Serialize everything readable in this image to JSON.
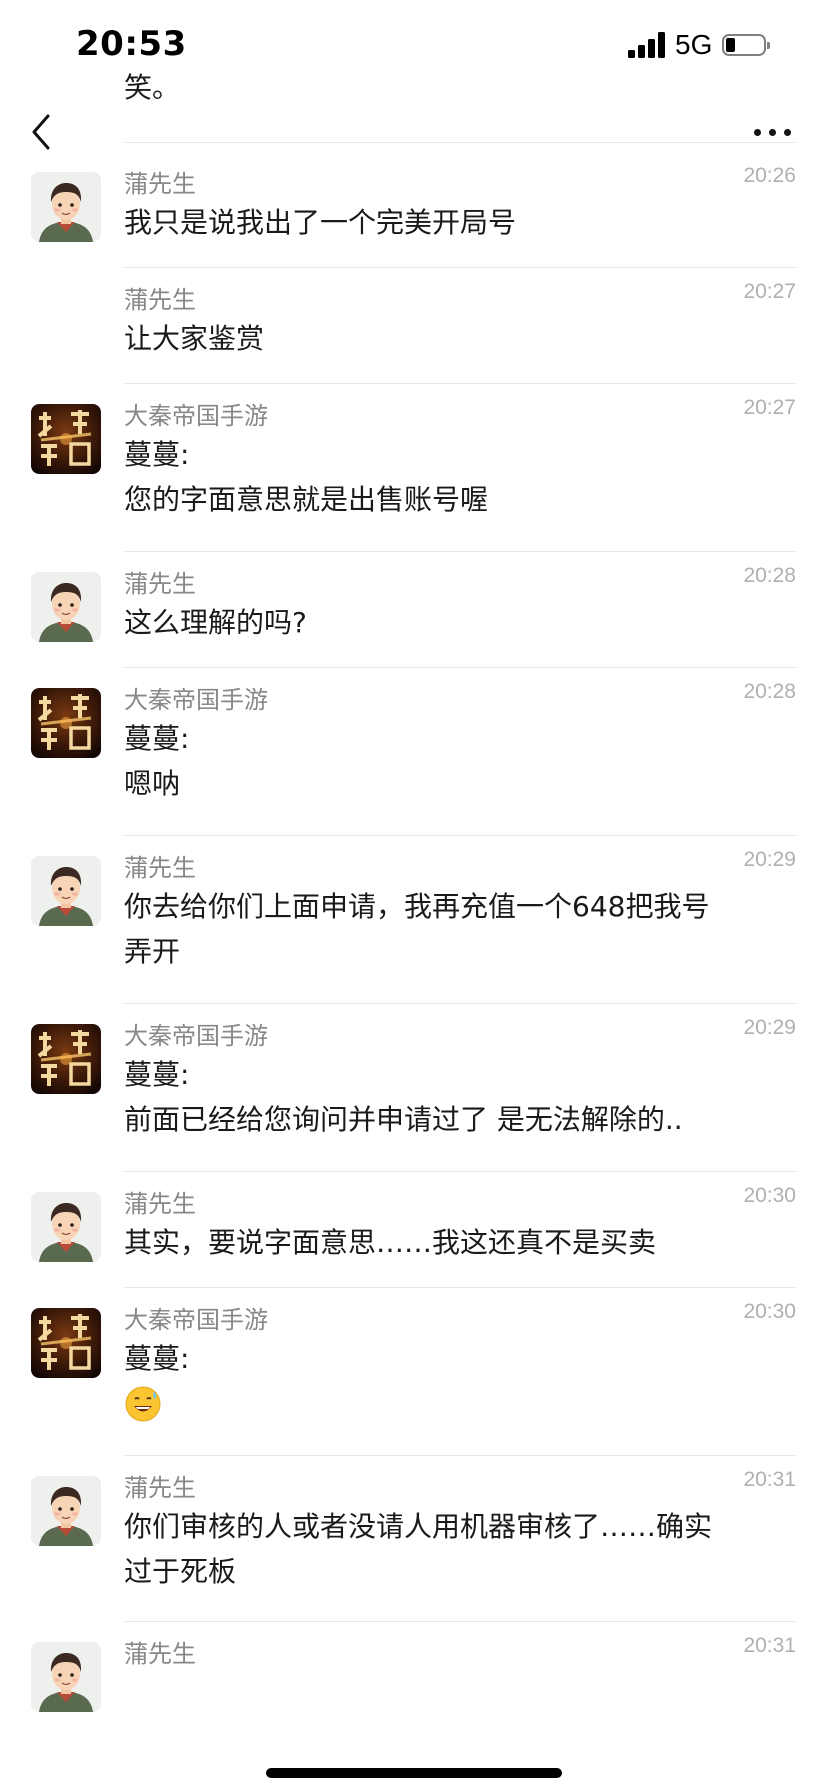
{
  "status_bar": {
    "time": "20:53",
    "network": "5G"
  },
  "nav": {
    "clipped_text": "笑。"
  },
  "messages": [
    {
      "avatar": "man-avatar",
      "sender": "蒲先生",
      "time": "20:26",
      "lines": [
        "我只是说我出了一个完美开局号"
      ]
    },
    {
      "avatar": null,
      "sender": "蒲先生",
      "time": "20:27",
      "lines": [
        "让大家鉴赏"
      ]
    },
    {
      "avatar": "game-logo",
      "sender": "大秦帝国手游",
      "time": "20:27",
      "lines": [
        "蔓蔓:",
        "您的字面意思就是出售账号喔"
      ]
    },
    {
      "avatar": "man-avatar",
      "sender": "蒲先生",
      "time": "20:28",
      "lines": [
        "这么理解的吗?"
      ]
    },
    {
      "avatar": "game-logo",
      "sender": "大秦帝国手游",
      "time": "20:28",
      "lines": [
        "蔓蔓:",
        "嗯呐"
      ]
    },
    {
      "avatar": "man-avatar",
      "sender": "蒲先生",
      "time": "20:29",
      "lines": [
        "你去给你们上面申请，我再充值一个648把我号",
        "弄开"
      ]
    },
    {
      "avatar": "game-logo",
      "sender": "大秦帝国手游",
      "time": "20:29",
      "lines": [
        "蔓蔓:",
        "前面已经给您询问并申请过了  是无法解除的.."
      ]
    },
    {
      "avatar": "man-avatar",
      "sender": "蒲先生",
      "time": "20:30",
      "lines": [
        "其实，要说字面意思……我这还真不是买卖"
      ]
    },
    {
      "avatar": "game-logo",
      "sender": "大秦帝国手游",
      "time": "20:30",
      "lines": [
        "蔓蔓:"
      ],
      "emoji": "sweat-smile-emoji"
    },
    {
      "avatar": "man-avatar",
      "sender": "蒲先生",
      "time": "20:31",
      "lines": [
        "你们审核的人或者没请人用机器审核了……确实",
        "过于死板"
      ]
    },
    {
      "avatar": "man-avatar",
      "sender": "蒲先生",
      "time": "20:31",
      "lines": []
    }
  ]
}
